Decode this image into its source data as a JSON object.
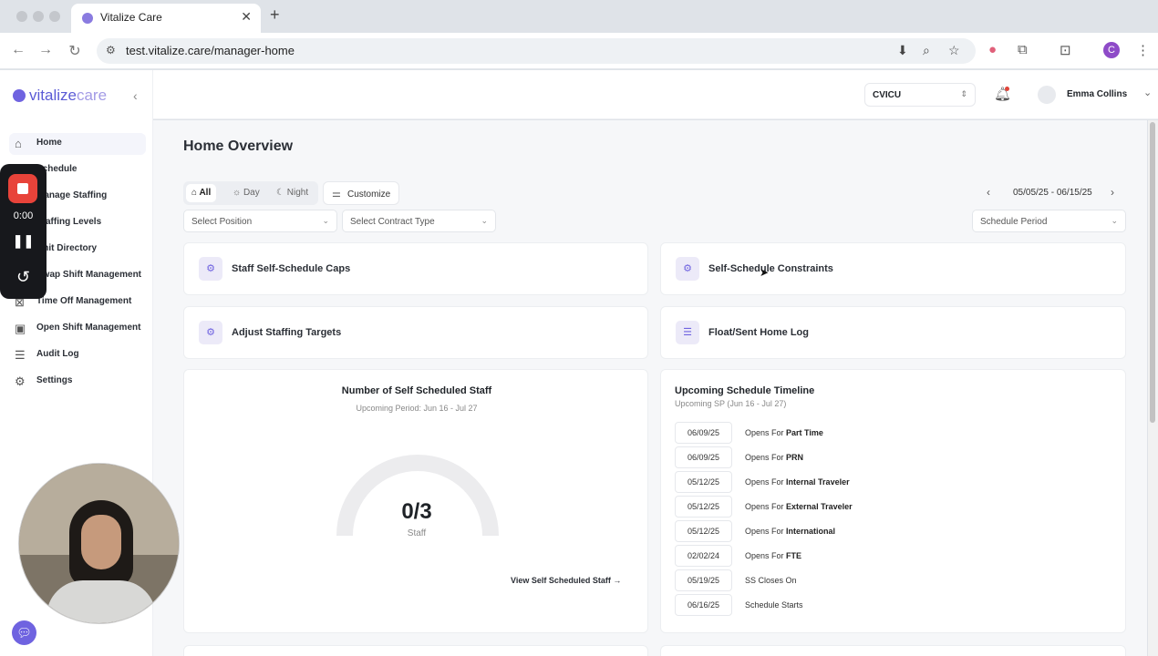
{
  "browser": {
    "tab_title": "Vitalize Care",
    "url": "test.vitalize.care/manager-home",
    "profile_initial": "C",
    "new_tab": "+",
    "close_tab": "✕"
  },
  "recorder": {
    "time": "0:00"
  },
  "brand": {
    "name_a": "vitalize",
    "name_b": "care"
  },
  "sidebar": {
    "items": [
      {
        "label": "Home",
        "icon": "home-icon",
        "active": true
      },
      {
        "label": "Schedule",
        "icon": "calendar-icon"
      },
      {
        "label": "Manage Staffing",
        "icon": "users-icon"
      },
      {
        "label": "Staffing Levels",
        "icon": "chart-icon"
      },
      {
        "label": "Unit Directory",
        "icon": "directory-icon"
      },
      {
        "label": "Swap Shift Management",
        "icon": "swap-icon"
      },
      {
        "label": "Time Off Management",
        "icon": "time-off-icon"
      },
      {
        "label": "Open Shift Management",
        "icon": "open-shift-icon"
      },
      {
        "label": "Audit Log",
        "icon": "list-icon"
      },
      {
        "label": "Settings",
        "icon": "gear-icon"
      }
    ]
  },
  "header": {
    "unit": "CVICU",
    "user_name": "Emma Collins"
  },
  "page": {
    "title": "Home Overview",
    "filters": {
      "all": "All",
      "day": "Day",
      "night": "Night",
      "customize": "Customize",
      "date_range": "05/05/25 - 06/15/25",
      "position_placeholder": "Select Position",
      "contract_placeholder": "Select Contract Type",
      "period_placeholder": "Schedule Period"
    },
    "quick_actions": [
      {
        "label": "Staff Self-Schedule Caps",
        "icon": "gear-icon"
      },
      {
        "label": "Self-Schedule Constraints",
        "icon": "gear-icon"
      },
      {
        "label": "Adjust Staffing Targets",
        "icon": "gear-icon"
      },
      {
        "label": "Float/Sent Home Log",
        "icon": "log-icon"
      }
    ],
    "self_scheduled": {
      "title": "Number of Self Scheduled Staff",
      "subtitle": "Upcoming Period: Jun 16 - Jul 27",
      "value": "0/3",
      "scheduled": 0,
      "total": 3,
      "unit": "Staff",
      "link": "View Self Scheduled Staff"
    },
    "timeline": {
      "title": "Upcoming Schedule Timeline",
      "subtitle": "Upcoming SP (Jun 16 - Jul 27)",
      "rows": [
        {
          "date": "06/09/25",
          "prefix": "Opens For",
          "target": "Part Time"
        },
        {
          "date": "06/09/25",
          "prefix": "Opens For",
          "target": "PRN"
        },
        {
          "date": "05/12/25",
          "prefix": "Opens For",
          "target": "Internal Traveler"
        },
        {
          "date": "05/12/25",
          "prefix": "Opens For",
          "target": "External Traveler"
        },
        {
          "date": "05/12/25",
          "prefix": "Opens For",
          "target": "International"
        },
        {
          "date": "02/02/24",
          "prefix": "Opens For",
          "target": "FTE"
        },
        {
          "date": "05/19/25",
          "prefix": "SS Closes On",
          "target": ""
        },
        {
          "date": "06/16/25",
          "prefix": "Schedule Starts",
          "target": ""
        }
      ]
    }
  },
  "colors": {
    "brand": "#6f63e0",
    "record": "#e8433a"
  }
}
